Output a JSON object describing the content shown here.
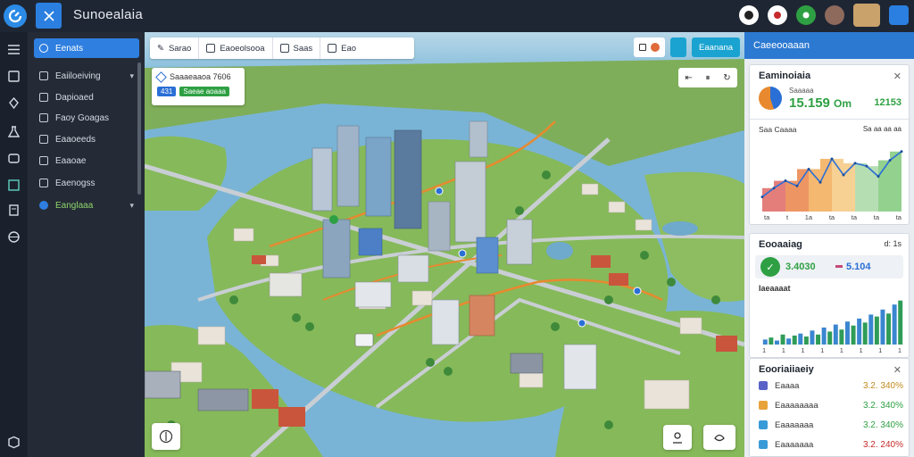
{
  "app": {
    "title": "Sunoealaia"
  },
  "sidebar": {
    "items": [
      {
        "label": "Eenats",
        "active": true
      },
      {
        "label": "Eaiiloeiving",
        "chevron": true
      },
      {
        "label": "Dapioaed"
      },
      {
        "label": "Faoy Goagas"
      },
      {
        "label": "Eaaoeeds"
      },
      {
        "label": "Eaaoae"
      },
      {
        "label": "Eaenogss"
      },
      {
        "label": "Eanglaaa",
        "green": true,
        "chevron": true
      }
    ]
  },
  "toolbar": {
    "items": [
      {
        "icon": "pencil-icon",
        "label": "Sarao"
      },
      {
        "icon": "layers-icon",
        "label": "Eaoeolsooa"
      },
      {
        "icon": "grid-icon",
        "label": "Saas"
      },
      {
        "icon": "filter-icon",
        "label": "Eao"
      }
    ]
  },
  "map_top_right": {
    "button_label": "Eaanana"
  },
  "info_card": {
    "title": "Saaaeaaoa 7606",
    "badge_blue": "431",
    "badge_green": "Saeae aoaaa"
  },
  "right_panel": {
    "header": "Caeeooaaan",
    "card1": {
      "title": "Eaminoiaia",
      "subtitle": "Saaaaa",
      "kpi": "15.159",
      "kpi_unit": "Om",
      "kpi_right": "12153",
      "chart_title": "Saa Caaaa",
      "chart_top_right": "Sa aa aa aa",
      "x_ticks": [
        "ta",
        "t",
        "1a",
        "ta",
        "ta",
        "ta",
        "ta"
      ]
    },
    "card2": {
      "title": "Eooaaiag",
      "icons_right": "d: 1s",
      "kpi_a": "3.4030",
      "kpi_b": "5.104",
      "chart_title": "Iaeaaaat",
      "x_ticks": [
        "1",
        "1",
        "1",
        "1",
        "1",
        "1",
        "1",
        "1"
      ]
    },
    "card3": {
      "title": "Eooriaiiaeiy",
      "rows": [
        {
          "label": "Eaaaa",
          "value": "3.2. 340%",
          "color": "#5a62c8"
        },
        {
          "label": "Eaaaaaaaa",
          "value": "3.2. 340%",
          "color": "#e8a23a"
        },
        {
          "label": "Eaaaaaaa",
          "value": "3.2. 340%",
          "color": "#3a9ad8"
        },
        {
          "label": "Eaaaaaaa",
          "value": "3.2. 240%",
          "color": "#3a9ad8"
        }
      ]
    }
  },
  "chart_data": [
    {
      "type": "area",
      "title": "Saa Caaaa",
      "x": [
        1,
        2,
        3,
        4,
        5,
        6,
        7,
        8,
        9,
        10,
        11,
        12,
        13
      ],
      "series": [
        {
          "values": [
            20,
            32,
            42,
            35,
            58,
            40,
            72,
            50,
            66,
            62,
            48,
            70,
            82
          ]
        }
      ],
      "ylim": [
        0,
        100
      ]
    },
    {
      "type": "bar",
      "title": "Iaeaaaat",
      "values": [
        10,
        14,
        8,
        20,
        12,
        18,
        22,
        16,
        28,
        20,
        34,
        26,
        40,
        30,
        46,
        38,
        52,
        44,
        60,
        56,
        70,
        62,
        80,
        88
      ],
      "ylim": [
        0,
        100
      ]
    }
  ]
}
